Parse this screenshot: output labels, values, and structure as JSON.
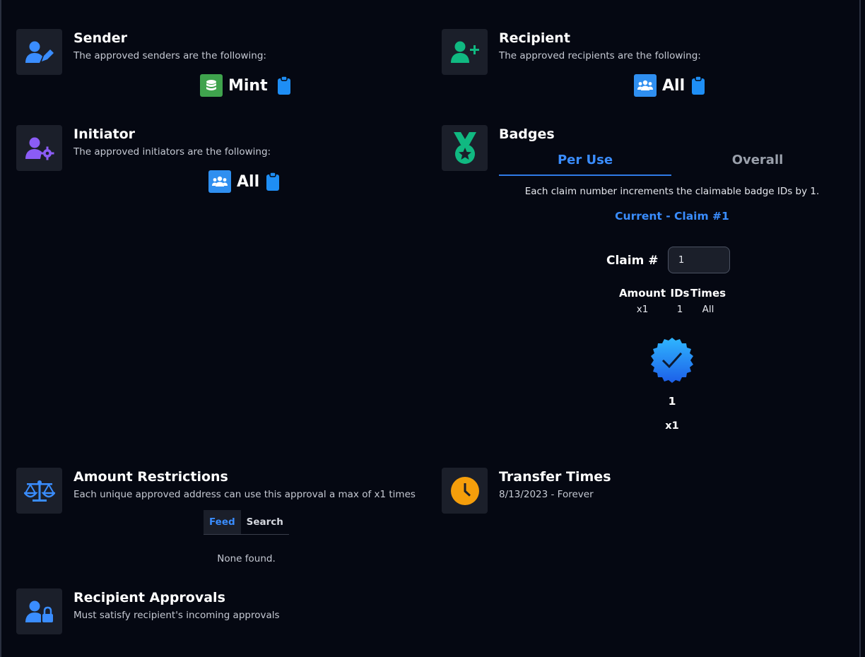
{
  "sender": {
    "title": "Sender",
    "description": "The approved senders are the following:",
    "chip_label": "Mint",
    "chip_color": "#3fa34d"
  },
  "recipient": {
    "title": "Recipient",
    "description": "The approved recipients are the following:",
    "chip_label": "All",
    "chip_color": "#2f8ff0"
  },
  "initiator": {
    "title": "Initiator",
    "description": "The approved initiators are the following:",
    "chip_label": "All",
    "chip_color": "#2f8ff0"
  },
  "badges": {
    "title": "Badges",
    "tabs": [
      "Per Use",
      "Overall"
    ],
    "active_tab": "Per Use",
    "increment_note": "Each claim number increments the claimable badge IDs by 1.",
    "current_claim": "Current - Claim #1",
    "claim_label": "Claim #",
    "claim_value": "1",
    "table_headers": [
      "Amount",
      "IDs",
      "Times"
    ],
    "table_row": [
      "x1",
      "1",
      "All"
    ],
    "badge_id": "1",
    "badge_amount": "x1"
  },
  "amount_restrictions": {
    "title": "Amount Restrictions",
    "description": "Each unique approved address can use this approval a max of x1 times",
    "tabs": [
      "Feed",
      "Search"
    ],
    "active_tab": "Feed",
    "empty_text": "None found."
  },
  "transfer_times": {
    "title": "Transfer Times",
    "range": "8/13/2023 - Forever"
  },
  "recipient_approvals": {
    "title": "Recipient Approvals",
    "description": "Must satisfy recipient's incoming approvals"
  },
  "colors": {
    "background": "#050812",
    "icon_box": "#1b1f2a",
    "accent_blue": "#3a8dff",
    "green": "#10b981",
    "purple": "#8b5cf6",
    "orange": "#f59e0b"
  }
}
